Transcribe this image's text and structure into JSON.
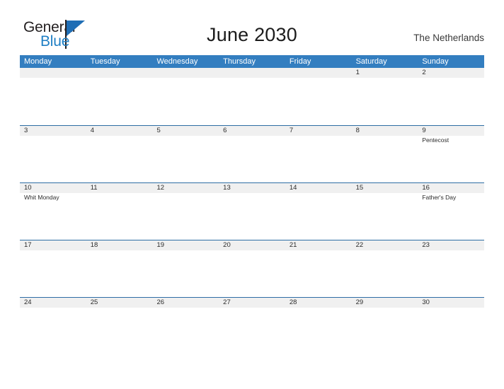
{
  "brand": {
    "name_part1": "General",
    "name_part2": "Blue",
    "flag_color": "#1f6eb5",
    "text_color_primary": "#231f20",
    "text_color_secondary": "#1f7fc4"
  },
  "header": {
    "title": "June 2030",
    "region": "The Netherlands"
  },
  "theme": {
    "header_bar": "#337ec0",
    "row_separator": "#2e6da4",
    "date_strip": "#f0f0f0",
    "page_background": "#ffffff",
    "text": "#2b2b2b"
  },
  "calendar": {
    "weekdays": [
      "Monday",
      "Tuesday",
      "Wednesday",
      "Thursday",
      "Friday",
      "Saturday",
      "Sunday"
    ],
    "weeks": [
      {
        "days": [
          {
            "num": "",
            "event": ""
          },
          {
            "num": "",
            "event": ""
          },
          {
            "num": "",
            "event": ""
          },
          {
            "num": "",
            "event": ""
          },
          {
            "num": "",
            "event": ""
          },
          {
            "num": "1",
            "event": ""
          },
          {
            "num": "2",
            "event": ""
          }
        ]
      },
      {
        "days": [
          {
            "num": "3",
            "event": ""
          },
          {
            "num": "4",
            "event": ""
          },
          {
            "num": "5",
            "event": ""
          },
          {
            "num": "6",
            "event": ""
          },
          {
            "num": "7",
            "event": ""
          },
          {
            "num": "8",
            "event": ""
          },
          {
            "num": "9",
            "event": "Pentecost"
          }
        ]
      },
      {
        "days": [
          {
            "num": "10",
            "event": "Whit Monday"
          },
          {
            "num": "11",
            "event": ""
          },
          {
            "num": "12",
            "event": ""
          },
          {
            "num": "13",
            "event": ""
          },
          {
            "num": "14",
            "event": ""
          },
          {
            "num": "15",
            "event": ""
          },
          {
            "num": "16",
            "event": "Father's Day"
          }
        ]
      },
      {
        "days": [
          {
            "num": "17",
            "event": ""
          },
          {
            "num": "18",
            "event": ""
          },
          {
            "num": "19",
            "event": ""
          },
          {
            "num": "20",
            "event": ""
          },
          {
            "num": "21",
            "event": ""
          },
          {
            "num": "22",
            "event": ""
          },
          {
            "num": "23",
            "event": ""
          }
        ]
      },
      {
        "days": [
          {
            "num": "24",
            "event": ""
          },
          {
            "num": "25",
            "event": ""
          },
          {
            "num": "26",
            "event": ""
          },
          {
            "num": "27",
            "event": ""
          },
          {
            "num": "28",
            "event": ""
          },
          {
            "num": "29",
            "event": ""
          },
          {
            "num": "30",
            "event": ""
          }
        ]
      }
    ]
  }
}
